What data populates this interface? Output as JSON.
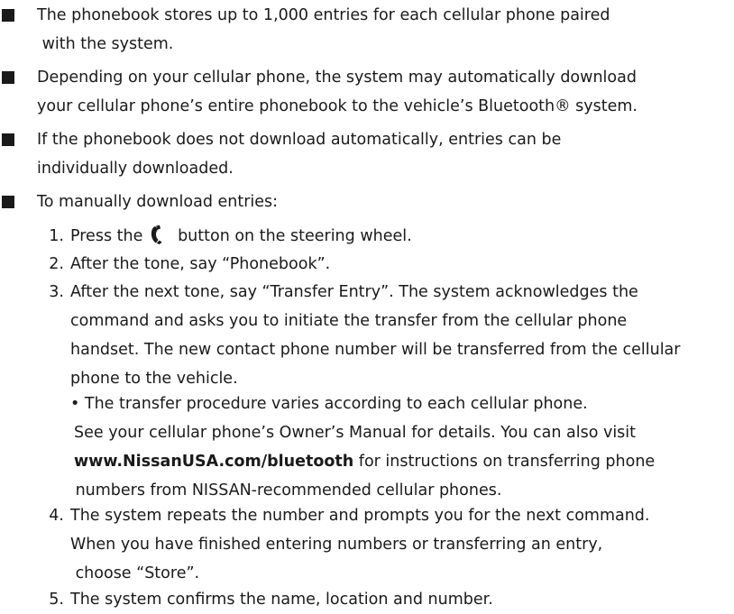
{
  "bullets": [
    {
      "lines": [
        "The phonebook stores up to 1,000 entries for each cellular phone paired",
        " with the system."
      ]
    },
    {
      "lines": [
        "Depending on your cellular phone, the system may automatically download",
        "your cellular phone’s entire phonebook to the vehicle’s Bluetooth® system."
      ]
    },
    {
      "lines": [
        "If the phonebook does not download automatically, entries can be",
        "individually downloaded."
      ]
    },
    {
      "lines": [
        "To manually download entries:"
      ]
    }
  ],
  "steps": [
    {
      "num": "1.",
      "before_icon": "Press the",
      "icon": "phone-handset-icon",
      "after_icon": " button on the steering wheel."
    },
    {
      "num": "2.",
      "lines": [
        "After the tone, say “Phonebook”."
      ]
    },
    {
      "num": "3.",
      "lines": [
        "After the next tone, say “Transfer Entry”. The system acknowledges the",
        "command and asks you to initiate the transfer from the cellular phone",
        "handset. The new contact phone number will be transferred from the cellular",
        "phone to the vehicle."
      ]
    },
    {
      "num": "4.",
      "lines": [
        "The system repeats the number and prompts you for the next command.",
        "When you have finished entering numbers or transferring an entry,",
        " choose “Store”."
      ]
    },
    {
      "num": "5.",
      "lines": [
        "The system confirms the name, location and number."
      ]
    }
  ],
  "note": {
    "line1": "• The transfer procedure varies according to each cellular phone.",
    "line2": "See your cellular phone’s Owner’s Manual for details. You can also visit",
    "url": "www.NissanUSA.com/bluetooth",
    "line3_rest": " for instructions on transferring phone",
    "line4": " numbers from NISSAN-recommended cellular phones."
  }
}
